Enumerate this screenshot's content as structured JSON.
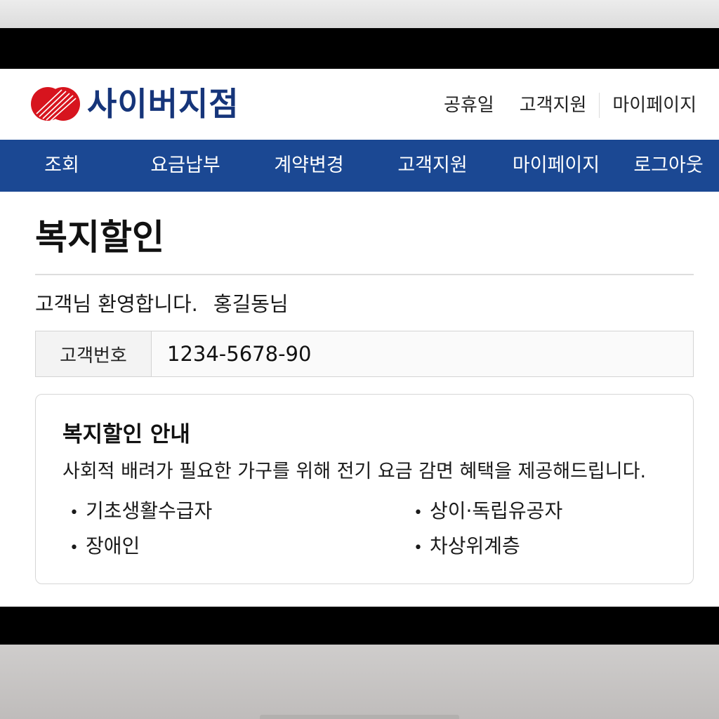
{
  "header": {
    "logo_text": "사이버지점",
    "links": [
      "공휴일",
      "고객지원",
      "마이페이지"
    ]
  },
  "nav": {
    "items": [
      "조회",
      "요금납부",
      "계약변경",
      "고객지원",
      "마이페이지",
      "로그아웃"
    ]
  },
  "main": {
    "title": "복지할인",
    "welcome_text": "고객님 환영합니다.",
    "customer_name": "홍길동님",
    "account": {
      "label": "고객번호",
      "value": "1234-5678-90"
    },
    "info": {
      "title": "복지할인 안내",
      "description": "사회적 배려가 필요한 가구를 위해 전기 요금 감면 혜택을 제공해드립니다.",
      "bullets": [
        "기초생활수급자",
        "상이·독립유공자",
        "장애인",
        "차상위계층"
      ]
    }
  },
  "colors": {
    "brand_navy": "#16357a",
    "nav_blue": "#1b4893",
    "logo_red": "#d7141e"
  },
  "icons": {
    "logo": "brand-logo-icon",
    "bullet": "bullet-dot-icon"
  }
}
